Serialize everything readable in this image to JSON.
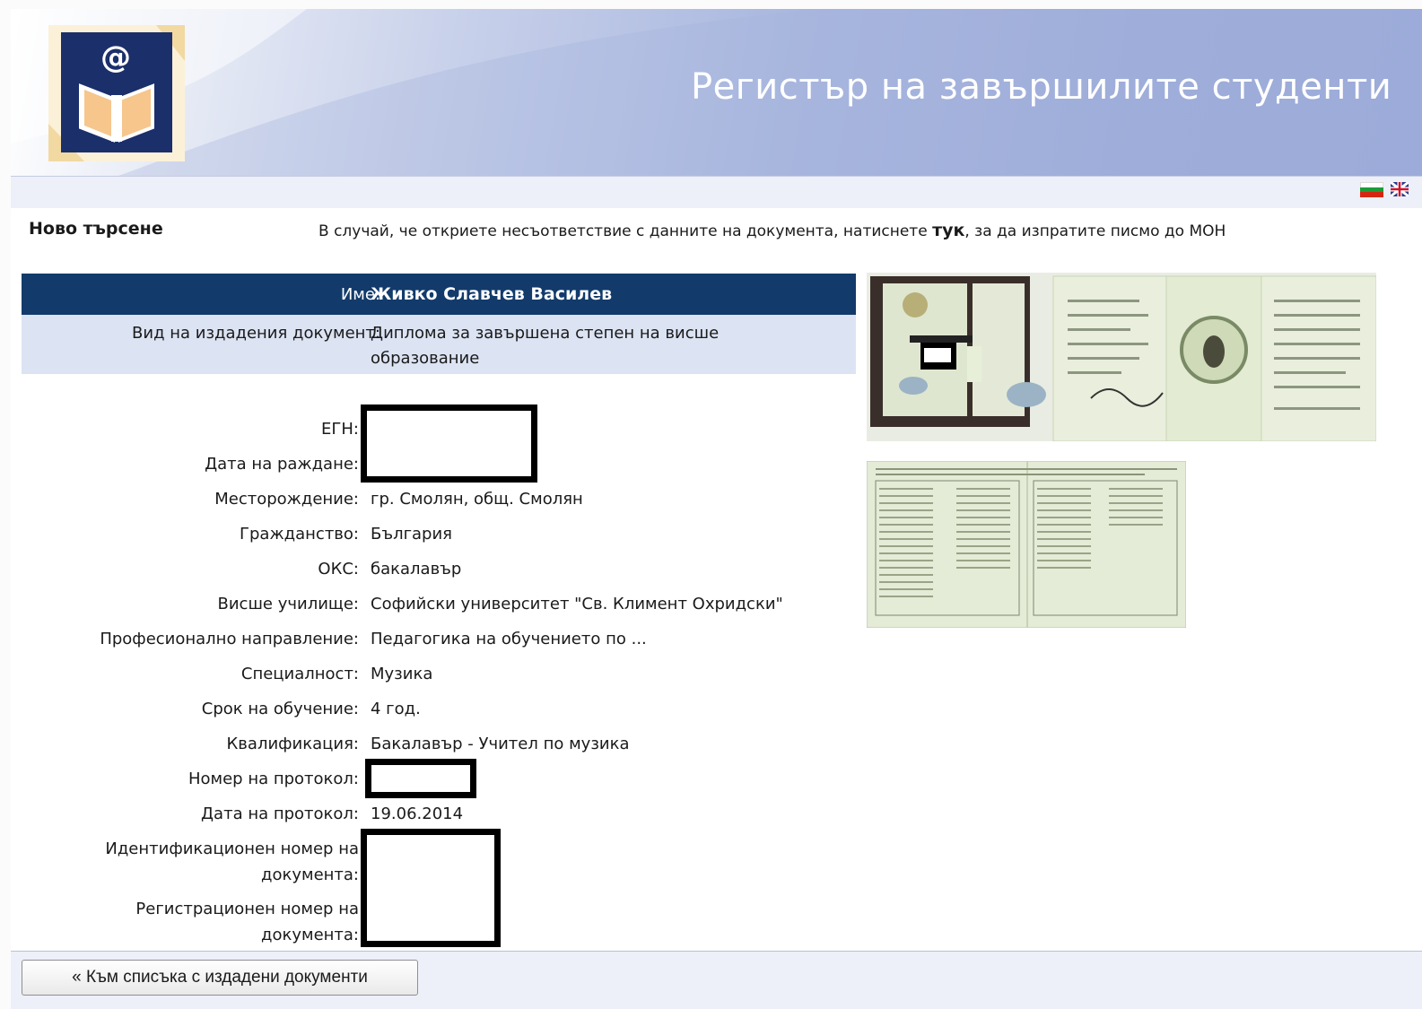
{
  "header": {
    "title": "Регистър на завършилите студенти",
    "logo_icon": "book-at-logo-icon",
    "logo_symbol": "@"
  },
  "languages": [
    "bg-flag-icon",
    "uk-flag-icon"
  ],
  "top": {
    "new_search": "Ново търсене",
    "notice_before": "В случай, че откриете несъответствие с данните на документа, натиснете ",
    "notice_link": "тук",
    "notice_after": ", за да изпратите писмо до МОН"
  },
  "record": {
    "name_label": "Име:",
    "name_value": "Живко Славчев Василев",
    "doc_type_label": "Вид на издадения документ:",
    "doc_type_value_line1": "Диплома за завършена степен на висше",
    "doc_type_value_line2": "образование",
    "egn_label": "ЕГН:",
    "birthdate_label": "Дата на раждане:",
    "birthplace_label": "Месторождение:",
    "birthplace_value": "гр. Смолян, общ. Смолян",
    "citizenship_label": "Гражданство:",
    "citizenship_value": "България",
    "oks_label": "ОКС:",
    "oks_value": "бакалавър",
    "university_label": "Висше училище:",
    "university_value": "Софийски университет \"Св. Климент Охридски\"",
    "field_label": "Професионално направление:",
    "field_value": "Педагогика на обучението по ...",
    "specialty_label": "Специалност:",
    "specialty_value": "Музика",
    "duration_label": "Срок на обучение:",
    "duration_value": "4 год.",
    "qualification_label": "Квалификация:",
    "qualification_value": "Бакалавър - Учител по музика",
    "protocol_num_label": "Номер на протокол:",
    "protocol_date_label": "Дата на протокол:",
    "protocol_date_value": "19.06.2014",
    "id_num_label_line1": "Идентификационен номер на",
    "id_num_label_line2": "документа:",
    "reg_num_label_line1": "Регистрационен номер на",
    "reg_num_label_line2": "документа:"
  },
  "colors": {
    "name_row_bg": "#123b6b",
    "doc_row_bg": "#dce3f3",
    "header_blue": "#9aa9d8"
  },
  "footer": {
    "back_button": "« Към списъка с издадени документи"
  }
}
